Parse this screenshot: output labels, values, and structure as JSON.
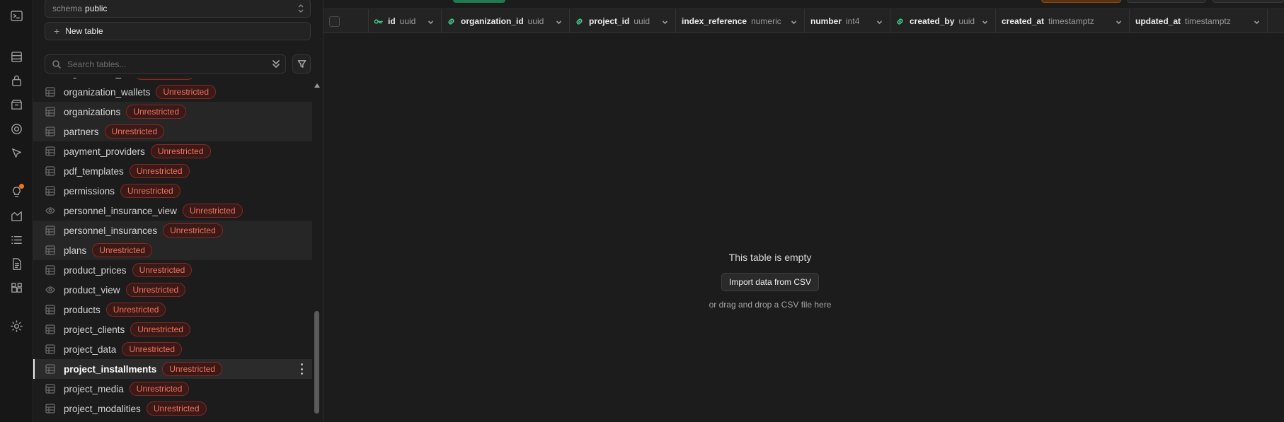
{
  "schema": {
    "label": "schema",
    "value": "public"
  },
  "new_table_label": "New table",
  "search": {
    "placeholder": "Search tables..."
  },
  "tables": [
    {
      "name": "organization_...",
      "badge": "Unrestricted",
      "kind": "table"
    },
    {
      "name": "organization_wallets",
      "badge": "Unrestricted",
      "kind": "table"
    },
    {
      "name": "organizations",
      "badge": "Unrestricted",
      "kind": "table"
    },
    {
      "name": "partners",
      "badge": "Unrestricted",
      "kind": "table"
    },
    {
      "name": "payment_providers",
      "badge": "Unrestricted",
      "kind": "table"
    },
    {
      "name": "pdf_templates",
      "badge": "Unrestricted",
      "kind": "table"
    },
    {
      "name": "permissions",
      "badge": "Unrestricted",
      "kind": "table"
    },
    {
      "name": "personnel_insurance_view",
      "badge": "Unrestricted",
      "kind": "view"
    },
    {
      "name": "personnel_insurances",
      "badge": "Unrestricted",
      "kind": "table"
    },
    {
      "name": "plans",
      "badge": "Unrestricted",
      "kind": "table"
    },
    {
      "name": "product_prices",
      "badge": "Unrestricted",
      "kind": "table"
    },
    {
      "name": "product_view",
      "badge": "Unrestricted",
      "kind": "view"
    },
    {
      "name": "products",
      "badge": "Unrestricted",
      "kind": "table"
    },
    {
      "name": "project_clients",
      "badge": "Unrestricted",
      "kind": "table"
    },
    {
      "name": "project_data",
      "badge": "Unrestricted",
      "kind": "table"
    },
    {
      "name": "project_installments",
      "badge": "Unrestricted",
      "kind": "table",
      "selected": true
    },
    {
      "name": "project_media",
      "badge": "Unrestricted",
      "kind": "table"
    },
    {
      "name": "project_modalities",
      "badge": "Unrestricted",
      "kind": "table"
    }
  ],
  "columns": [
    {
      "name": "id",
      "type": "uuid",
      "icon": "key-icon"
    },
    {
      "name": "organization_id",
      "type": "uuid",
      "icon": "link-icon"
    },
    {
      "name": "project_id",
      "type": "uuid",
      "icon": "link-icon"
    },
    {
      "name": "index_reference",
      "type": "numeric",
      "icon": ""
    },
    {
      "name": "number",
      "type": "int4",
      "icon": ""
    },
    {
      "name": "created_by",
      "type": "uuid",
      "icon": "link-icon"
    },
    {
      "name": "created_at",
      "type": "timestamptz",
      "icon": ""
    },
    {
      "name": "updated_at",
      "type": "timestamptz",
      "icon": ""
    }
  ],
  "empty_state": {
    "title": "This table is empty",
    "import_button": "Import data from CSV",
    "subtitle": "or drag and drop a CSV file here"
  },
  "colors": {
    "accent": "#3ecf8e",
    "badge_text": "#f0735f",
    "badge_bg": "#3a1916",
    "notification": "#f97316"
  }
}
